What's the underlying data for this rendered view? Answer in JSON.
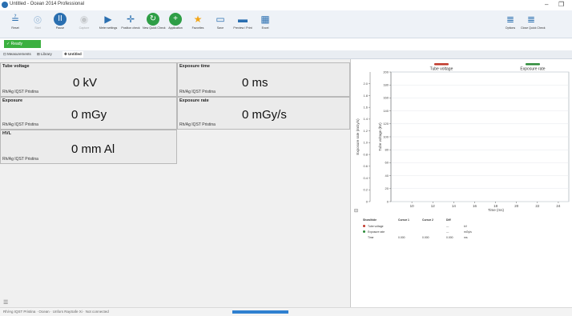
{
  "window": {
    "title": "Untitled - Ocean 2014 Professional",
    "minimize": "–",
    "restore": "❐"
  },
  "ribbon": {
    "left": [
      {
        "name": "reset-button",
        "label": "Reset",
        "glyph": "≟",
        "color": "#2a6fb0",
        "dim": false,
        "circle": false
      },
      {
        "name": "start-button",
        "label": "Start",
        "glyph": "◎",
        "color": "#2a6fb0",
        "dim": true,
        "circle": false
      },
      {
        "name": "pause-button",
        "label": "Pause",
        "glyph": "II",
        "color": "#2a6fb0",
        "dim": false,
        "circle": true
      },
      {
        "name": "capture-button",
        "label": "Capture",
        "glyph": "◉",
        "color": "#888888",
        "dim": true,
        "circle": false
      },
      {
        "name": "meter-settings-button",
        "label": "Meter settings",
        "glyph": "▶",
        "color": "#2a6fb0",
        "dim": false,
        "circle": false
      },
      {
        "name": "position-check-button",
        "label": "Position check",
        "glyph": "✛",
        "color": "#2a6fb0",
        "dim": false,
        "circle": false
      },
      {
        "name": "new-quick-check-button",
        "label": "New Quick Check",
        "glyph": "↻",
        "color": "#2e9e46",
        "dim": false,
        "circle": true
      },
      {
        "name": "application-button",
        "label": "Application",
        "glyph": "+",
        "color": "#2e9e46",
        "dim": false,
        "circle": true
      },
      {
        "name": "favorites-button",
        "label": "Favorites",
        "glyph": "★",
        "color": "#f2a516",
        "dim": false,
        "circle": false
      },
      {
        "name": "save-button",
        "label": "Save",
        "glyph": "▭",
        "color": "#2a6fb0",
        "dim": false,
        "circle": false
      },
      {
        "name": "preview-print-button",
        "label": "Preview / Print",
        "glyph": "▬",
        "color": "#2a6fb0",
        "dim": false,
        "circle": false
      },
      {
        "name": "excel-button",
        "label": "Excel",
        "glyph": "▦",
        "color": "#2a6fb0",
        "dim": false,
        "circle": false
      }
    ],
    "right": [
      {
        "name": "options-button",
        "label": "Options",
        "glyph": "≣",
        "color": "#2a6fb0",
        "dim": false,
        "circle": false
      },
      {
        "name": "close-quick-check-button",
        "label": "Close Quick Check",
        "glyph": "≣",
        "color": "#2a6fb0",
        "dim": false,
        "circle": false
      }
    ]
  },
  "status": {
    "ready": "✓ Ready"
  },
  "tabs": [
    {
      "label": "⊡ Measurements",
      "active": false
    },
    {
      "label": "⊞ Library",
      "active": false
    },
    {
      "label": "✚ Untitled",
      "active": true
    }
  ],
  "cards": [
    {
      "name": "tube-voltage-card",
      "caption": "Tube voltage",
      "value": "0 kV",
      "footer": "Rh/Ag IQST Pristina"
    },
    {
      "name": "exposure-time-card",
      "caption": "Exposure time",
      "value": "0 ms",
      "footer": "Rh/Ag IQST Pristina"
    },
    {
      "name": "exposure-card",
      "caption": "Exposure",
      "value": "0 mGy",
      "footer": "Rh/Ag IQST Pristina"
    },
    {
      "name": "exposure-rate-card",
      "caption": "Exposure rate",
      "value": "0 mGy/s",
      "footer": "Rh/Ag IQST Pristina"
    },
    {
      "name": "hvl-card",
      "caption": "HVL",
      "value": "0 mm Al",
      "footer": "Rh/Ag IQST Pristina"
    }
  ],
  "chart_data": {
    "type": "line",
    "legend": [
      {
        "name": "Tube voltage",
        "color": "#c0392b"
      },
      {
        "name": "Exposure rate",
        "color": "#2e8b3a"
      }
    ],
    "xlabel": "Time (ms)",
    "x_ticks": [
      10,
      12,
      14,
      16,
      18,
      20,
      22,
      24
    ],
    "xlim": [
      8,
      25
    ],
    "y_left_label": "Exposure rate (mGy/s)",
    "y_left_ticks": [
      "0",
      "0.2",
      "0.4",
      "0.6",
      "0.8",
      "1.0",
      "1.2",
      "1.4",
      "1.6",
      "1.8",
      "2.0"
    ],
    "y_left_lim": [
      0,
      2.2
    ],
    "y_right_label": "Tube voltage (kV)",
    "y_right_ticks": [
      0,
      20,
      40,
      60,
      80,
      100,
      120,
      140,
      160,
      180,
      200
    ],
    "y_right_lim": [
      0,
      200
    ],
    "grid": true,
    "series": []
  },
  "cursor_table": {
    "headers": [
      "Show/hide",
      "Cursor 1",
      "Cursor 2",
      "Diff",
      ""
    ],
    "rows": [
      {
        "label": "Tube voltage",
        "color": "#c0392b",
        "c1": "",
        "c2": "",
        "diff": "---",
        "unit": "kV"
      },
      {
        "label": "Exposure rate",
        "color": "#2e8b3a",
        "c1": "",
        "c2": "",
        "diff": "---",
        "unit": "mGy/s"
      },
      {
        "label": "Time",
        "color": "",
        "c1": "0.000",
        "c2": "0.000",
        "diff": "0.000",
        "unit": "ms"
      }
    ]
  },
  "bottom": {
    "info": "Rh/Ag IQST Pristina · Ocean · Unfors RaySafe Xi · Not connected"
  }
}
